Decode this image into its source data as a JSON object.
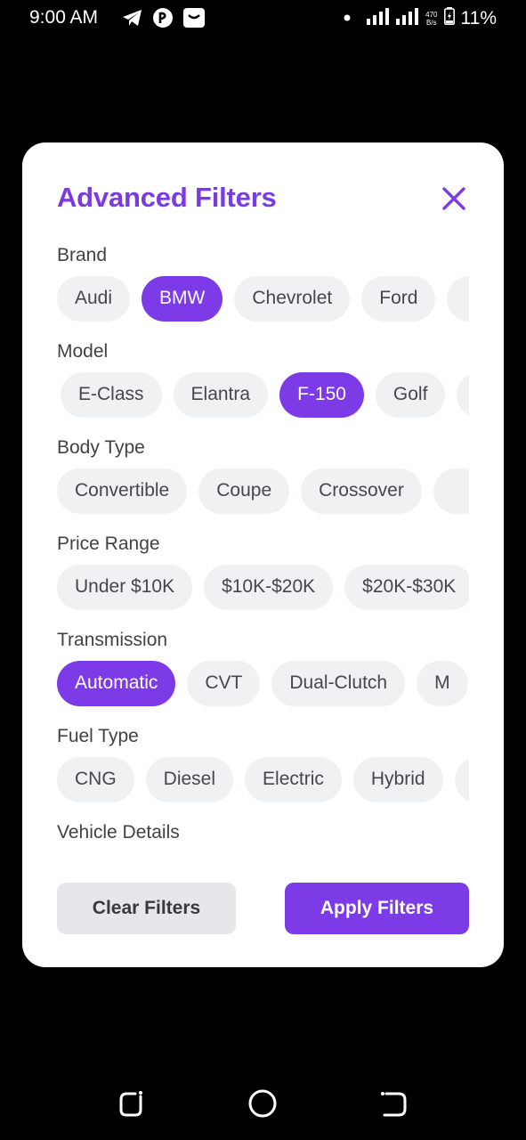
{
  "status_bar": {
    "time": "9:00 AM",
    "net_speed_value": "470",
    "net_speed_unit": "B/s",
    "battery": "11%",
    "icons": [
      "telegram-icon",
      "messenger-icon",
      "shopping-bag-icon",
      "dot-icon",
      "signal-icon",
      "signal-icon",
      "battery-icon"
    ]
  },
  "modal": {
    "title": "Advanced Filters",
    "close_icon": "close-icon",
    "sections": [
      {
        "label": "Brand",
        "chips": [
          "Audi",
          "BMW",
          "Chevrolet",
          "Ford"
        ],
        "selected": "BMW"
      },
      {
        "label": "Model",
        "chips": [
          "E-Class",
          "Elantra",
          "F-150",
          "Golf"
        ],
        "selected": "F-150"
      },
      {
        "label": "Body Type",
        "chips": [
          "Convertible",
          "Coupe",
          "Crossover"
        ],
        "selected": ""
      },
      {
        "label": "Price Range",
        "chips": [
          "Under $10K",
          "$10K-$20K",
          "$20K-$30K"
        ],
        "selected": ""
      },
      {
        "label": "Transmission",
        "chips": [
          "Automatic",
          "CVT",
          "Dual-Clutch",
          "M"
        ],
        "selected": "Automatic"
      },
      {
        "label": "Fuel Type",
        "chips": [
          "CNG",
          "Diesel",
          "Electric",
          "Hybrid"
        ],
        "selected": ""
      },
      {
        "label": "Vehicle Details",
        "chips": [],
        "selected": ""
      }
    ],
    "clear_label": "Clear Filters",
    "apply_label": "Apply Filters"
  },
  "colors": {
    "accent": "#7c3be6",
    "chip_bg": "#f0f1f3",
    "clear_bg": "#e6e7ea"
  },
  "nav": {
    "icons": [
      "recent-apps-icon",
      "home-icon",
      "back-icon"
    ]
  }
}
